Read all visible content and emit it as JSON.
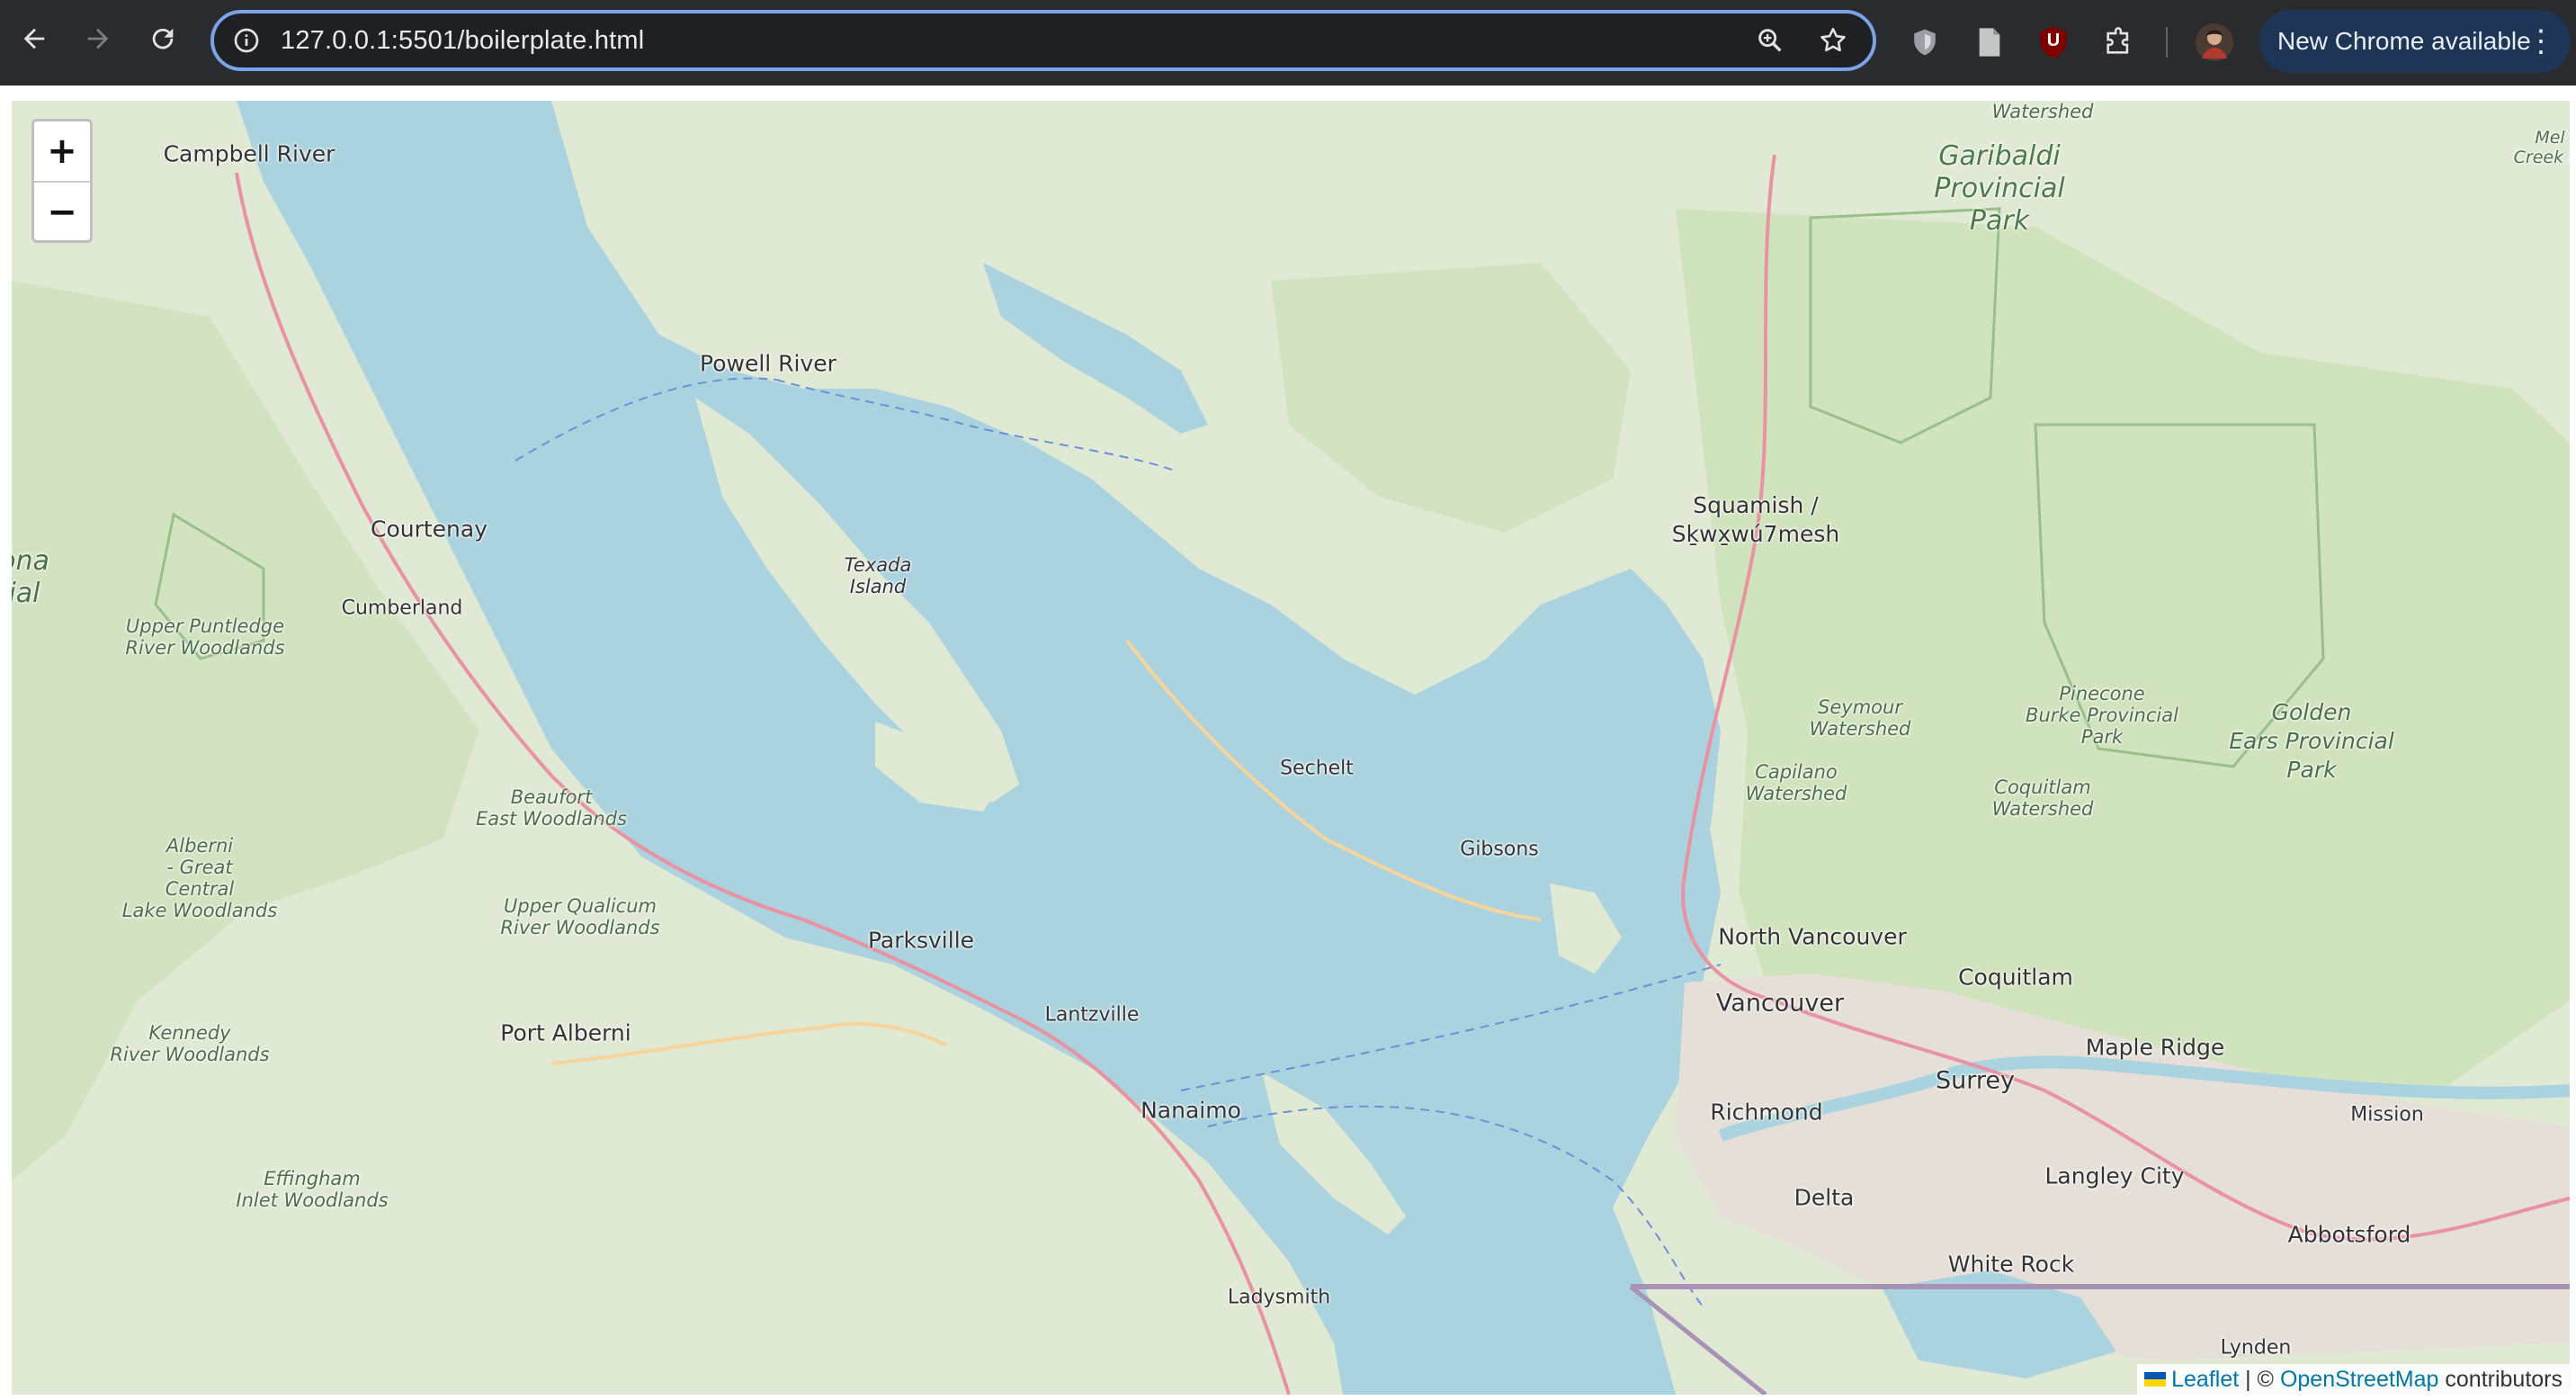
{
  "browser": {
    "url": "127.0.0.1:5501/boilerplate.html",
    "update_label": "New Chrome available",
    "extension_badge": "U",
    "icons": {
      "back": "arrow-left-icon",
      "forward": "arrow-right-icon",
      "reload": "reload-icon",
      "site_info": "info-circle-icon",
      "zoom": "magnifier-zoom-icon",
      "bookmark": "star-icon",
      "extension_shield": "shield-icon",
      "reader": "document-icon",
      "extensions": "puzzle-icon",
      "profile": "avatar",
      "menu": "kebab-menu-icon"
    }
  },
  "map": {
    "zoom_in_label": "+",
    "zoom_out_label": "−",
    "labels": {
      "campbell_river": "Campbell River",
      "powell_river": "Powell River",
      "courtenay": "Courtenay",
      "cumberland": "Cumberland",
      "texada": "Texada\nIsland",
      "upper_puntledge": "Upper Puntledge\nRiver Woodlands",
      "beaufort": "Beaufort\nEast Woodlands",
      "alberni_great": "Alberni\n- Great\nCentral\nLake Woodlands",
      "upper_qualicum": "Upper Qualicum\nRiver Woodlands",
      "parksville": "Parksville",
      "port_alberni": "Port Alberni",
      "kennedy": "Kennedy\nRiver Woodlands",
      "lantzville": "Lantzville",
      "nanaimo": "Nanaimo",
      "effingham": "Effingham\nInlet Woodlands",
      "ladysmith": "Ladysmith",
      "sechelt": "Sechelt",
      "gibsons": "Gibsons",
      "squamish": "Squamish /\nSḵwx̱wú7mesh",
      "garibaldi": "Garibaldi\nProvincial\nPark",
      "seymour": "Seymour\nWatershed",
      "capilano": "Capilano\nWatershed",
      "pinecone": "Pinecone\nBurke Provincial\nPark",
      "coquitlam_ws": "Coquitlam\nWatershed",
      "golden_ears": "Golden\nEars Provincial\nPark",
      "north_vancouver": "North Vancouver",
      "vancouver": "Vancouver",
      "coquitlam": "Coquitlam",
      "maple_ridge": "Maple Ridge",
      "surrey": "Surrey",
      "richmond": "Richmond",
      "mission": "Mission",
      "langley": "Langley City",
      "delta": "Delta",
      "abbotsford": "Abbotsford",
      "white_rock": "White Rock",
      "lynden": "Lynden",
      "edge_left": "ona\nial",
      "edge_right": "Mel\nCreek Pr"
    },
    "attribution": {
      "leaflet": "Leaflet",
      "separator": " | © ",
      "osm": "OpenStreetMap",
      "contributors": " contributors"
    },
    "colors": {
      "water": "#aad3df",
      "land": "#dfe9d3",
      "forest": "#c8dfb4",
      "urban": "#e6dfd8",
      "highway": "#e892a2",
      "road": "#f7d49b",
      "boundary": "#a893b6",
      "ferry": "#6f8fd6"
    }
  }
}
